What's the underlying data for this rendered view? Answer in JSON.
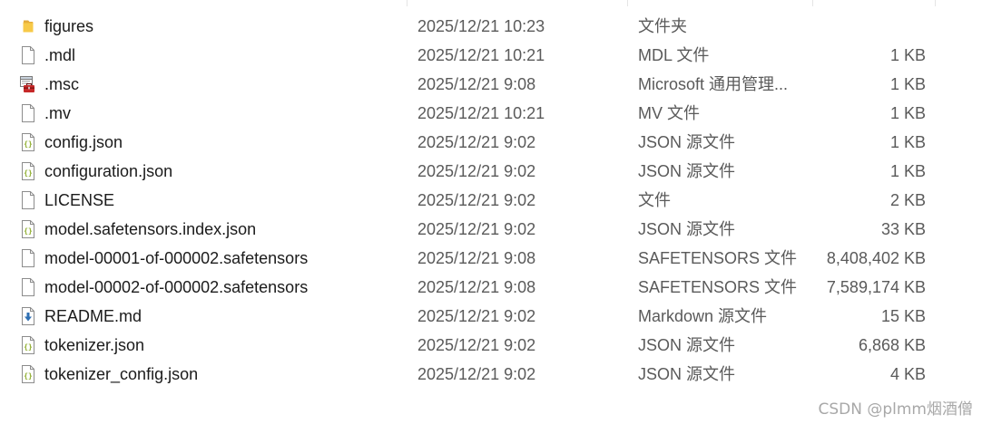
{
  "files": [
    {
      "name": "figures",
      "modified": "2025/12/21 10:23",
      "type": "文件夹",
      "size": "",
      "icon": "folder-icon"
    },
    {
      "name": ".mdl",
      "modified": "2025/12/21 10:21",
      "type": "MDL 文件",
      "size": "1 KB",
      "icon": "blank-file-icon"
    },
    {
      "name": ".msc",
      "modified": "2025/12/21 9:08",
      "type": "Microsoft 通用管理...",
      "size": "1 KB",
      "icon": "msc-toolbox-icon"
    },
    {
      "name": ".mv",
      "modified": "2025/12/21 10:21",
      "type": "MV 文件",
      "size": "1 KB",
      "icon": "blank-file-icon"
    },
    {
      "name": "config.json",
      "modified": "2025/12/21 9:02",
      "type": "JSON 源文件",
      "size": "1 KB",
      "icon": "json-file-icon"
    },
    {
      "name": "configuration.json",
      "modified": "2025/12/21 9:02",
      "type": "JSON 源文件",
      "size": "1 KB",
      "icon": "json-file-icon"
    },
    {
      "name": "LICENSE",
      "modified": "2025/12/21 9:02",
      "type": "文件",
      "size": "2 KB",
      "icon": "blank-file-icon"
    },
    {
      "name": "model.safetensors.index.json",
      "modified": "2025/12/21 9:02",
      "type": "JSON 源文件",
      "size": "33 KB",
      "icon": "json-file-icon"
    },
    {
      "name": "model-00001-of-000002.safetensors",
      "modified": "2025/12/21 9:08",
      "type": "SAFETENSORS 文件",
      "size": "8,408,402 KB",
      "icon": "blank-file-icon"
    },
    {
      "name": "model-00002-of-000002.safetensors",
      "modified": "2025/12/21 9:08",
      "type": "SAFETENSORS 文件",
      "size": "7,589,174 KB",
      "icon": "blank-file-icon"
    },
    {
      "name": "README.md",
      "modified": "2025/12/21 9:02",
      "type": "Markdown 源文件",
      "size": "15 KB",
      "icon": "markdown-file-icon"
    },
    {
      "name": "tokenizer.json",
      "modified": "2025/12/21 9:02",
      "type": "JSON 源文件",
      "size": "6,868 KB",
      "icon": "json-file-icon"
    },
    {
      "name": "tokenizer_config.json",
      "modified": "2025/12/21 9:02",
      "type": "JSON 源文件",
      "size": "4 KB",
      "icon": "json-file-icon"
    }
  ],
  "watermark": "CSDN @plmm烟酒僧",
  "colors": {
    "folder": "#f7c948",
    "json_brace": "#8fae2e",
    "markdown": "#2f6fb3",
    "toolbox": "#c62828",
    "secondary_text": "#5a5a5a"
  }
}
